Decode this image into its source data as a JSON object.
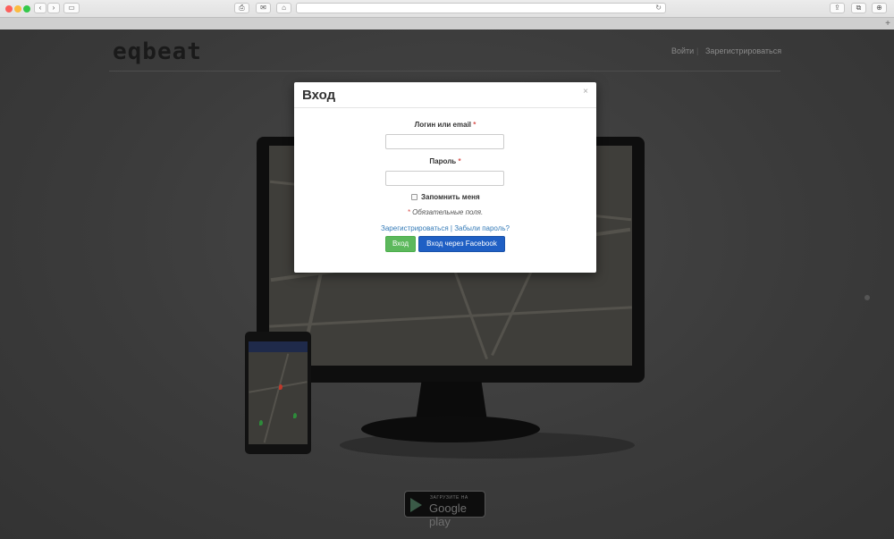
{
  "browser": {
    "toolbar_glyphs": {
      "back": "‹",
      "forward": "›",
      "sidebar": "▭",
      "print": "⎙",
      "mail": "✉",
      "home": "⌂",
      "reload": "↻",
      "share": "⇪",
      "tabs": "⧉",
      "downloads": "⊕",
      "new_tab": "+"
    }
  },
  "header": {
    "logo": "eqbeat",
    "nav": [
      {
        "label": "Войти"
      },
      {
        "label": "Зарегистрироваться"
      }
    ],
    "nav_separator": "|"
  },
  "store_badge": {
    "small_text": "ЗАГРУЗИТЕ НА",
    "big_text": "Google play"
  },
  "modal": {
    "title": "Вход",
    "close": "×",
    "login_label": "Логин или email",
    "password_label": "Пароль",
    "required_mark": "*",
    "login_value": "",
    "password_value": "",
    "remember_label": "Запомнить меня",
    "remember_checked": false,
    "required_note": "Обязательные поля.",
    "register_link": "Зарегистрироваться",
    "link_separator": "|",
    "forgot_link": "Забыли пароль?",
    "login_button": "Вход",
    "facebook_button": "Вход через Facebook"
  },
  "colors": {
    "success": "#5cb85c",
    "facebook": "#1f5fc4",
    "link": "#337ab7",
    "required": "#d9534f"
  }
}
